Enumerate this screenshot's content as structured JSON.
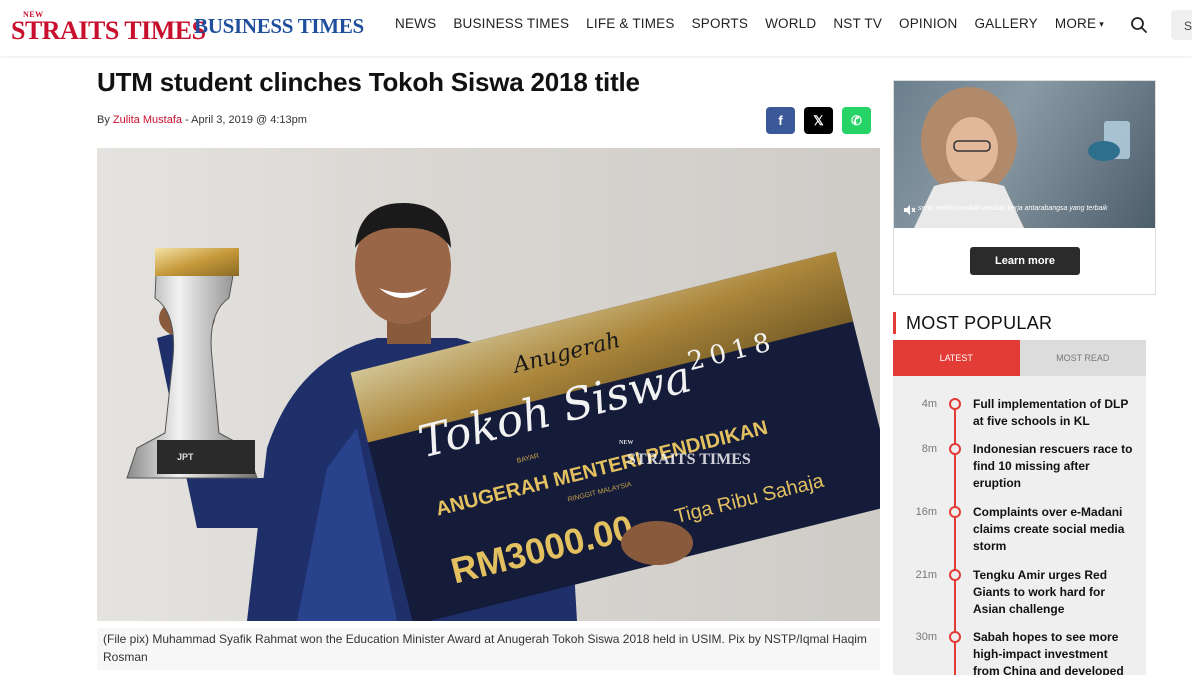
{
  "header": {
    "logo_new": "NEW",
    "logo_main": "STRAITS TIMES",
    "logo_business": "BUSINESS TIMES",
    "nav": [
      "NEWS",
      "BUSINESS TIMES",
      "LIFE & TIMES",
      "SPORTS",
      "WORLD",
      "NST TV",
      "OPINION",
      "GALLERY",
      "MORE"
    ],
    "search_icon": "search-icon",
    "edge_letter": "S"
  },
  "article": {
    "headline": "UTM student clinches Tokoh Siswa 2018 title",
    "by_prefix": "By ",
    "author": "Zulita Mustafa",
    "date": " - April 3, 2019 @ 4:13pm",
    "share": {
      "facebook": "f",
      "x": "𝕏",
      "whatsapp": "✆"
    },
    "photo": {
      "cheque_top": "Anugerah",
      "cheque_title": "Tokoh Siswa",
      "cheque_year": "2018",
      "cheque_award": "ANUGERAH MENTERI PENDIDIKAN",
      "cheque_amount": "RM3000.00",
      "cheque_words": "Tiga Ribu Sahaja",
      "cheque_pay": "BAYAR",
      "cheque_ringgit": "RINGGIT MALAYSIA",
      "watermark_new": "NEW",
      "watermark": "STRAITS TIMES",
      "trophy_label": "JPT"
    },
    "caption": "(File pix) Muhammad Syafik Rahmat won the Education Minister Award at Anugerah Tokoh Siswa 2018 held in USIM. Pix by NSTP/Iqmal Haqim Rosman"
  },
  "ad": {
    "subtitle": "serta melaksanakan amalan kerja antarabangsa yang terbaik",
    "button": "Learn more"
  },
  "most_popular": {
    "title": "MOST POPULAR",
    "tabs": [
      "LATEST",
      "MOST READ"
    ],
    "items": [
      {
        "time": "4m",
        "title": "Full implementation of DLP at five schools in KL"
      },
      {
        "time": "8m",
        "title": "Indonesian rescuers race to find 10 missing after eruption"
      },
      {
        "time": "16m",
        "title": "Complaints over e-Madani claims create social media storm"
      },
      {
        "time": "21m",
        "title": "Tengku Amir urges Red Giants to work hard for Asian challenge"
      },
      {
        "time": "30m",
        "title": "Sabah hopes to see more high-impact investment from China and developed"
      }
    ]
  },
  "colors": {
    "brand_red": "#c8102e",
    "bt_blue": "#1f4e9c",
    "accent": "#e33b36",
    "facebook": "#3b5998",
    "whatsapp": "#25d366"
  }
}
